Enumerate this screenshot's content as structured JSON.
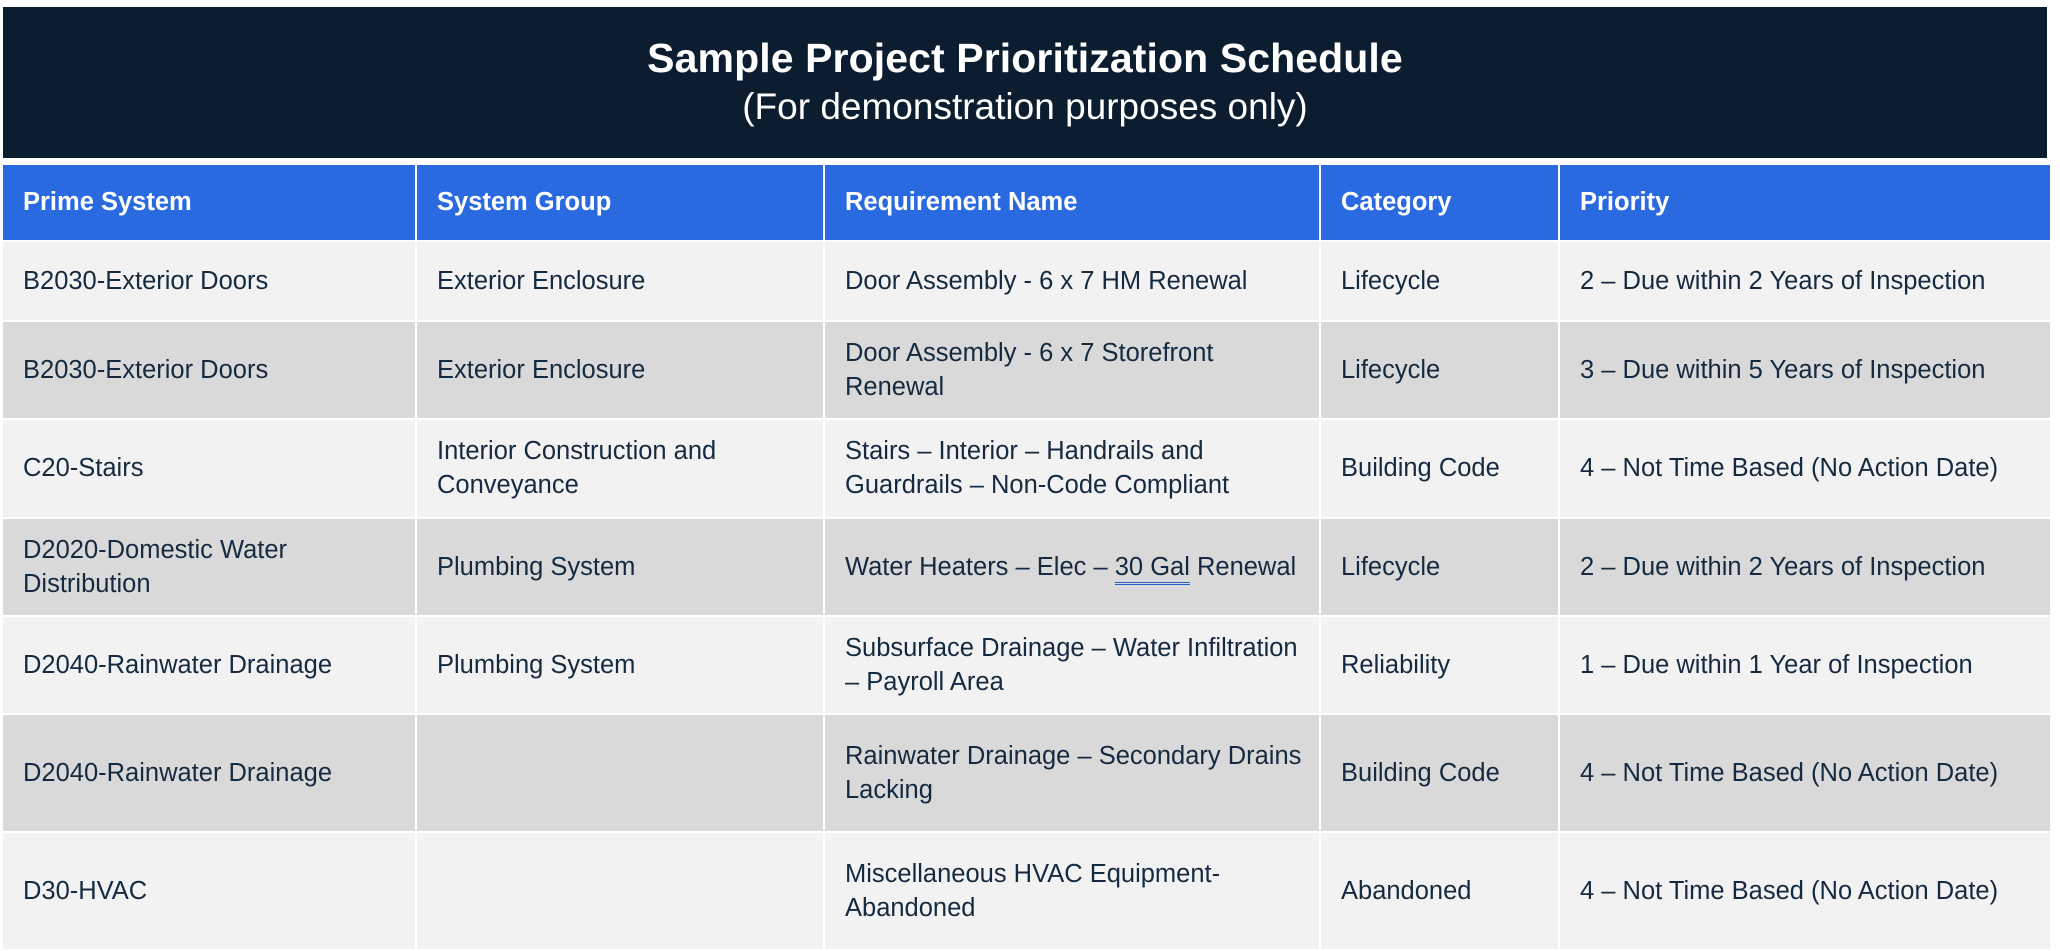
{
  "title": {
    "line1": "Sample Project Prioritization Schedule",
    "line2": "(For demonstration purposes only)"
  },
  "colors": {
    "title_band": "#0c1d30",
    "header_row": "#2a6ae1",
    "row_light": "#f2f2f2",
    "row_dark": "#d9d9d9",
    "body_text": "#152a40",
    "grammar_underline": "#2d5ec9"
  },
  "table": {
    "columns": [
      "Prime System",
      "System Group",
      "Requirement Name",
      "Category",
      "Priority"
    ],
    "rows": [
      {
        "prime_system": "B2030-Exterior Doors",
        "system_group": "Exterior Enclosure",
        "requirement_name": "Door Assembly - 6 x 7 HM Renewal",
        "category": "Lifecycle",
        "priority": "2 – Due within 2 Years of Inspection"
      },
      {
        "prime_system": "B2030-Exterior Doors",
        "system_group": "Exterior Enclosure",
        "requirement_name": "Door Assembly - 6 x 7 Storefront Renewal",
        "category": "Lifecycle",
        "priority": "3 – Due within 5 Years of Inspection"
      },
      {
        "prime_system": "C20-Stairs",
        "system_group": "Interior Construction and Conveyance",
        "requirement_name": "Stairs – Interior – Handrails and Guardrails – Non-Code Compliant",
        "category": "Building Code",
        "priority": "4 – Not Time Based (No Action Date)"
      },
      {
        "prime_system": "D2020-Domestic Water Distribution",
        "system_group": "Plumbing System",
        "requirement_name_pre": "Water Heaters – Elec – ",
        "requirement_name_marked": "30 Gal",
        "requirement_name_post": " Renewal",
        "category": "Lifecycle",
        "priority": "2 – Due within 2 Years of Inspection"
      },
      {
        "prime_system": "D2040-Rainwater Drainage",
        "system_group": "Plumbing System",
        "requirement_name": "Subsurface Drainage – Water Infiltration – Payroll Area",
        "category": "Reliability",
        "priority": "1 – Due within 1 Year of Inspection"
      },
      {
        "prime_system": "D2040-Rainwater Drainage",
        "system_group": "",
        "requirement_name": "Rainwater Drainage – Secondary Drains Lacking",
        "category": "Building Code",
        "priority": "4 – Not Time Based (No Action Date)"
      },
      {
        "prime_system": "D30-HVAC",
        "system_group": "",
        "requirement_name": "Miscellaneous HVAC Equipment-Abandoned",
        "category": "Abandoned",
        "priority": "4 – Not Time Based (No Action Date)"
      }
    ]
  }
}
